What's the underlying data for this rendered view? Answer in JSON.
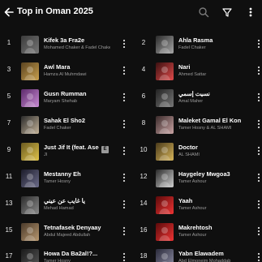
{
  "header": {
    "title": "Top in Oman 2025"
  },
  "icons": {
    "back": "arrow-back-icon",
    "search": "search-icon",
    "filter": "filter-icon",
    "more": "more-vert-icon"
  },
  "left_column": [
    {
      "rank": "1",
      "song": "Kifek 3a Fra2e",
      "artist": "Mohamed Chaker & Fadel Chaker",
      "thumb": [
        "#3b3b3b",
        "#777"
      ]
    },
    {
      "rank": "3",
      "song": "Awl Mara",
      "artist": "Hamza Al Muhmdawi",
      "thumb": [
        "#5a4320",
        "#c9a04e"
      ]
    },
    {
      "rank": "5",
      "song": "Gusn Rumman",
      "artist": "Maryam Shehab",
      "thumb": [
        "#5c2a6a",
        "#c98bd4"
      ]
    },
    {
      "rank": "7",
      "song": "Sahak El Sho2",
      "artist": "Fadel Chaker",
      "thumb": [
        "#2a2a2a",
        "#c5b49a"
      ]
    },
    {
      "rank": "9",
      "song": "Just Jif It (feat. Aseel Omran)",
      "artist": "JI",
      "thumb": [
        "#6a5a20",
        "#e0c34a"
      ],
      "explicit": "E"
    },
    {
      "rank": "11",
      "song": "Mestanny Eh",
      "artist": "Tamer Hosny",
      "thumb": [
        "#1c1c2a",
        "#6c6c8a"
      ]
    },
    {
      "rank": "13",
      "song": "يا غايب عن عيني",
      "artist": "Mehad Hamad",
      "thumb": [
        "#2c2c2c",
        "#8a8a8a"
      ]
    },
    {
      "rank": "15",
      "song": "Tetnafasek Denyaay",
      "artist": "Abdul Majeed Abdullah",
      "thumb": [
        "#4a3a2a",
        "#b89870"
      ]
    },
    {
      "rank": "17",
      "song": "Howa Da Ba2al!?...",
      "artist": "Tamer Hosny",
      "thumb": [
        "#1a1a1a",
        "#555"
      ]
    }
  ],
  "right_column": [
    {
      "rank": "2",
      "song": "Ahla Rasma",
      "artist": "Fadel Chaker",
      "thumb": [
        "#2a2a2a",
        "#a7a7a7"
      ]
    },
    {
      "rank": "4",
      "song": "Nari",
      "artist": "Ahmed Sattar",
      "thumb": [
        "#3a1010",
        "#e04a4a"
      ]
    },
    {
      "rank": "6",
      "song": "نسيت إسمي",
      "artist": "Amal Maher",
      "thumb": [
        "#222",
        "#777"
      ]
    },
    {
      "rank": "8",
      "song": "Maleket Gamal El Kon",
      "artist": "Tamer Hosny & AL SHAMI",
      "thumb": [
        "#3a2a2a",
        "#c9a3a3"
      ]
    },
    {
      "rank": "10",
      "song": "Doctor",
      "artist": "AL SHAMI",
      "thumb": [
        "#4a3a1a",
        "#d6b45a"
      ]
    },
    {
      "rank": "12",
      "song": "Haygeley Mwgoa3",
      "artist": "Tamer Ashour",
      "thumb": [
        "#2a2a2a",
        "#cfcfcf"
      ]
    },
    {
      "rank": "14",
      "song": "Yaah",
      "artist": "Tamer Ashour",
      "thumb": [
        "#5a0a0a",
        "#e33"
      ]
    },
    {
      "rank": "16",
      "song": "Makrehtosh",
      "artist": "Tamer Ashour",
      "thumb": [
        "#5a0a0a",
        "#e33"
      ]
    },
    {
      "rank": "18",
      "song": "Yabn Elawadem",
      "artist": "Abd Elmoneim Mohaddab",
      "thumb": [
        "#2a2a3a",
        "#8a8aa0"
      ]
    }
  ]
}
